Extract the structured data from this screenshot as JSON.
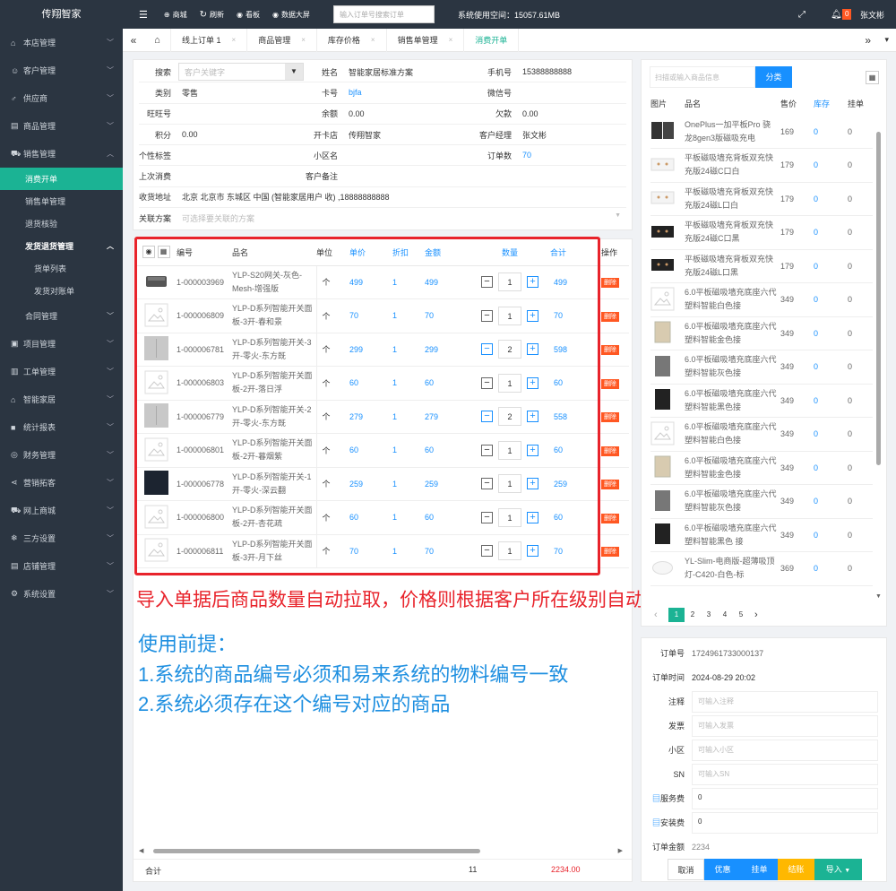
{
  "app": {
    "title": "传翔智家"
  },
  "sidebar": {
    "items": [
      {
        "icon": "⌂",
        "label": "本店管理"
      },
      {
        "icon": "☺",
        "label": "客户管理"
      },
      {
        "icon": "♂",
        "label": "供应商"
      },
      {
        "icon": "▤",
        "label": "商品管理"
      },
      {
        "icon": "⛟",
        "label": "销售管理"
      }
    ],
    "sales_sub": [
      {
        "label": "消费开单",
        "active": true
      },
      {
        "label": "销售单管理"
      },
      {
        "label": "退货核验"
      },
      {
        "label": "发货退货管理"
      }
    ],
    "ship_sub": [
      {
        "label": "货单列表"
      },
      {
        "label": "发货对账单"
      }
    ],
    "contract": {
      "label": "合同管理"
    },
    "bottom_items": [
      {
        "icon": "▣",
        "label": "项目管理"
      },
      {
        "icon": "▥",
        "label": "工单管理"
      },
      {
        "icon": "⌂",
        "label": "智能家居"
      },
      {
        "icon": "■",
        "label": "统计报表"
      },
      {
        "icon": "◎",
        "label": "财务管理"
      },
      {
        "icon": "⋖",
        "label": "营销拓客"
      },
      {
        "icon": "⛟",
        "label": "网上商城"
      },
      {
        "icon": "❄",
        "label": "三方设置"
      },
      {
        "icon": "▤",
        "label": "店铺管理"
      },
      {
        "icon": "⚙",
        "label": "系统设置"
      }
    ]
  },
  "topbar": {
    "menu_icon": "☰",
    "mall": "商城",
    "refresh": "刷新",
    "board": "看板",
    "screen": "数据大屏",
    "search_placeholder": "输入订单号搜索订单",
    "space": "系统使用空间：15057.61MB",
    "badge": "0",
    "user": "张文彬"
  },
  "tabs": [
    "线上订单 1",
    "商品管理",
    "库存价格",
    "销售单管理",
    "消费开单"
  ],
  "customer": {
    "search_label": "搜索",
    "search_placeholder": "客户关键字",
    "name_label": "姓名",
    "name": "智能家居标准方案",
    "phone_label": "手机号",
    "phone": "15388888888",
    "type_label": "类别",
    "type": "零售",
    "card_label": "卡号",
    "card": "bjfa",
    "wechat_label": "微信号",
    "wechat": "",
    "wangwang_label": "旺旺号",
    "wangwang": "",
    "balance_label": "余额",
    "balance": "0.00",
    "owed_label": "欠款",
    "owed": "0.00",
    "points_label": "积分",
    "points": "0.00",
    "store_label": "开卡店",
    "store": "传翔智家",
    "manager_label": "客户经理",
    "manager": "张文彬",
    "tag_label": "个性标签",
    "tag": "",
    "community_label": "小区名",
    "community": "",
    "orders_label": "订单数",
    "orders": "70",
    "last_label": "上次消费",
    "last": "",
    "remark_label": "客户备注",
    "remark": "",
    "addr_label": "收货地址",
    "addr": "北京 北京市 东城区 中国 (智能家居用户 收) ,18888888888",
    "plan_label": "关联方案",
    "plan_placeholder": "可选择要关联的方案"
  },
  "products": {
    "headers": {
      "code": "编号",
      "name": "品名",
      "unit": "单位",
      "price": "单价",
      "discount": "折扣",
      "amount": "金额",
      "qty": "数量",
      "total": "合计",
      "op": "操作"
    },
    "del_label": "删除",
    "rows": [
      {
        "code": "1-000003969",
        "name": "YLP-S20网关-灰色-Mesh-增强版",
        "unit": "个",
        "price": "499",
        "discount": "1",
        "amount": "499",
        "qty": "1",
        "total": "499",
        "img": "device"
      },
      {
        "code": "1-000006809",
        "name": "YLP-D系列智能开关面板-3开-春和景",
        "unit": "个",
        "price": "70",
        "discount": "1",
        "amount": "70",
        "qty": "1",
        "total": "70",
        "img": "placeholder"
      },
      {
        "code": "1-000006781",
        "name": "YLP-D系列智能开关-3开-零火-东方既",
        "unit": "个",
        "price": "299",
        "discount": "1",
        "amount": "299",
        "qty": "2",
        "total": "598",
        "img": "panel-gray"
      },
      {
        "code": "1-000006803",
        "name": "YLP-D系列智能开关面板-2开-落日浮",
        "unit": "个",
        "price": "60",
        "discount": "1",
        "amount": "60",
        "qty": "1",
        "total": "60",
        "img": "placeholder"
      },
      {
        "code": "1-000006779",
        "name": "YLP-D系列智能开关-2开-零火-东方既",
        "unit": "个",
        "price": "279",
        "discount": "1",
        "amount": "279",
        "qty": "2",
        "total": "558",
        "img": "panel-gray"
      },
      {
        "code": "1-000006801",
        "name": "YLP-D系列智能开关面板-2开-暮烟紫",
        "unit": "个",
        "price": "60",
        "discount": "1",
        "amount": "60",
        "qty": "1",
        "total": "60",
        "img": "placeholder"
      },
      {
        "code": "1-000006778",
        "name": "YLP-D系列智能开关-1开-零火-深云翻",
        "unit": "个",
        "price": "259",
        "discount": "1",
        "amount": "259",
        "qty": "1",
        "total": "259",
        "img": "panel-dark"
      },
      {
        "code": "1-000006800",
        "name": "YLP-D系列智能开关面板-2开-杏花疏",
        "unit": "个",
        "price": "60",
        "discount": "1",
        "amount": "60",
        "qty": "1",
        "total": "60",
        "img": "placeholder"
      },
      {
        "code": "1-000006811",
        "name": "YLP-D系列智能开关面板-3开-月下丝",
        "unit": "个",
        "price": "70",
        "discount": "1",
        "amount": "70",
        "qty": "1",
        "total": "70",
        "img": "placeholder"
      }
    ],
    "footer": {
      "label": "合计",
      "qty": "11",
      "total": "2234.00"
    }
  },
  "annotation": {
    "red": "导入单据后商品数量自动拉取，价格则根据客户所在级别自动生成",
    "blue1": "使用前提：",
    "blue2": "1.系统的商品编号必须和易来系统的物料编号一致",
    "blue3": "2.系统必须存在这个编号对应的商品"
  },
  "catalog": {
    "search_placeholder": "扫描或输入商品信息",
    "class_btn": "分类",
    "headers": {
      "img": "图片",
      "name": "品名",
      "price": "售价",
      "stock": "库存",
      "hang": "挂单"
    },
    "rows": [
      {
        "name": "OnePlus一加平板Pro 骁龙8gen3版磁吸充电",
        "price": "169",
        "stock": "0",
        "hang": "0",
        "img": "dark-two"
      },
      {
        "name": "平板磁吸墙充背板双充快充版24磁C口白",
        "price": "179",
        "stock": "0",
        "hang": "0",
        "img": "white-board"
      },
      {
        "name": "平板磁吸墙充背板双充快充版24磁L口白",
        "price": "179",
        "stock": "0",
        "hang": "0",
        "img": "white-board"
      },
      {
        "name": "平板磁吸墙充背板双充快充版24磁C口黑",
        "price": "179",
        "stock": "0",
        "hang": "0",
        "img": "black-board"
      },
      {
        "name": "平板磁吸墙充背板双充快充版24磁L口黑",
        "price": "179",
        "stock": "0",
        "hang": "0",
        "img": "black-board"
      },
      {
        "name": "6.0平板磁吸墙充底座六代塑料智能白色接",
        "price": "349",
        "stock": "0",
        "hang": "0",
        "img": "placeholder"
      },
      {
        "name": "6.0平板磁吸墙充底座六代塑料智能金色接",
        "price": "349",
        "stock": "0",
        "hang": "0",
        "img": "gold"
      },
      {
        "name": "6.0平板磁吸墙充底座六代塑料智能灰色接",
        "price": "349",
        "stock": "0",
        "hang": "0",
        "img": "gray-dev"
      },
      {
        "name": "6.0平板磁吸墙充底座六代塑料智能黑色接",
        "price": "349",
        "stock": "0",
        "hang": "0",
        "img": "black-dev"
      },
      {
        "name": "6.0平板磁吸墙充底座六代塑料智能白色接",
        "price": "349",
        "stock": "0",
        "hang": "0",
        "img": "placeholder"
      },
      {
        "name": "6.0平板磁吸墙充底座六代塑料智能金色接",
        "price": "349",
        "stock": "0",
        "hang": "0",
        "img": "gold"
      },
      {
        "name": "6.0平板磁吸墙充底座六代塑料智能灰色接",
        "price": "349",
        "stock": "0",
        "hang": "0",
        "img": "gray-dev"
      },
      {
        "name": "6.0平板磁吸墙充底座六代塑料智能黑色 接",
        "price": "349",
        "stock": "0",
        "hang": "0",
        "img": "black-dev"
      },
      {
        "name": "YL-Slim-电商版-超薄吸顶灯-C420-白色-标",
        "price": "369",
        "stock": "0",
        "hang": "0",
        "img": "lamp"
      }
    ],
    "pages": [
      "1",
      "2",
      "3",
      "4",
      "5"
    ],
    "prev": "‹",
    "next": "›"
  },
  "order": {
    "no_label": "订单号",
    "no": "1724961733000137",
    "time_label": "订单时间",
    "time": "2024-08-29 20:02",
    "note_label": "注释",
    "note_ph": "可输入注释",
    "invoice_label": "发票",
    "invoice_ph": "可输入发票",
    "community_label": "小区",
    "community_ph": "可输入小区",
    "sn_label": "SN",
    "sn_ph": "可输入SN",
    "service_label": "服务费",
    "service": "0",
    "install_label": "安装费",
    "install": "0",
    "amount_label": "订单金额",
    "amount": "2234",
    "buttons": {
      "cancel": "取消",
      "discount": "优惠",
      "hang": "挂单",
      "settle": "结账",
      "import": "导入"
    }
  },
  "colors": {
    "accent": "#1bb394",
    "blue": "#1890ff",
    "red": "#ff5722",
    "annotation_red": "#e8232b",
    "annotation_blue": "#1e8fe0"
  }
}
